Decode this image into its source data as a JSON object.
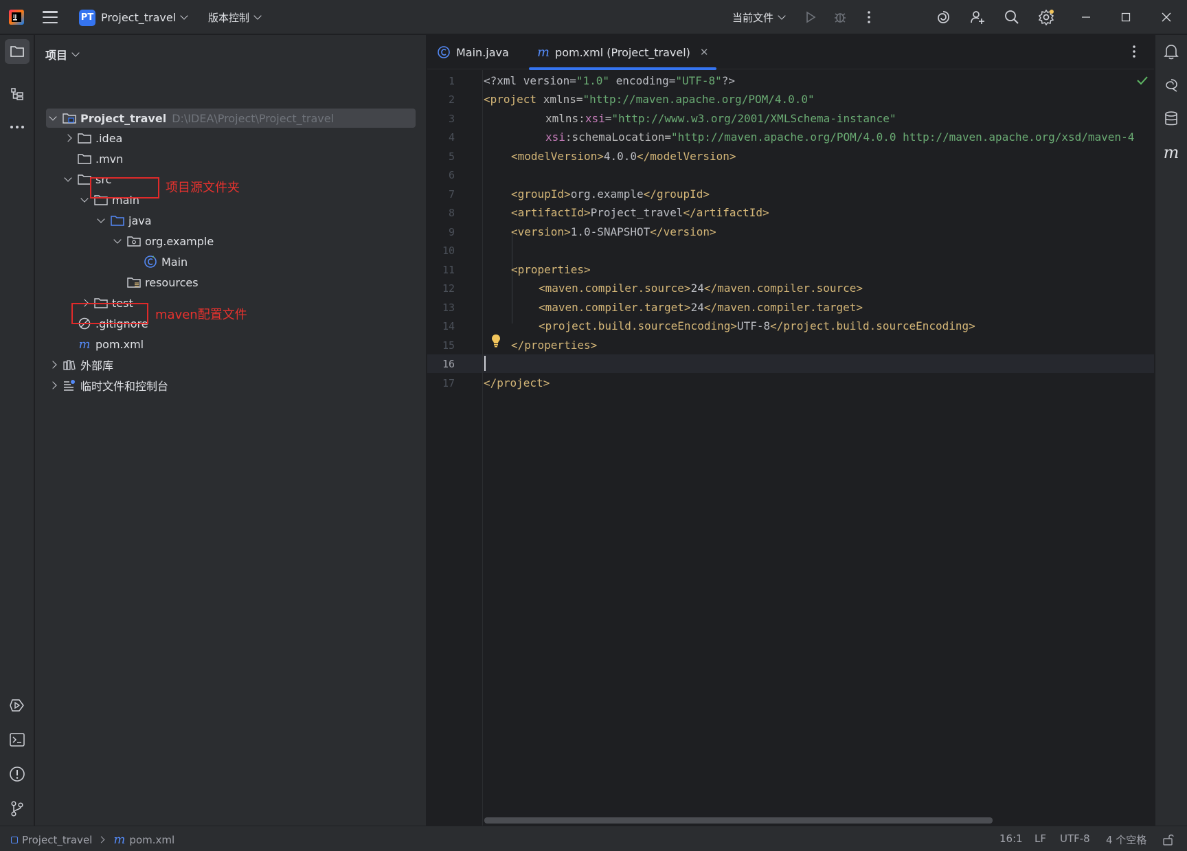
{
  "titlebar": {
    "project_badge": "PT",
    "project_name": "Project_travel",
    "vcs_label": "版本控制",
    "run_config": "当前文件"
  },
  "project_panel": {
    "title": "项目",
    "root_name": "Project_travel",
    "root_path": "D:\\IDEA\\Project\\Project_travel",
    "items": {
      "idea": ".idea",
      "mvn": ".mvn",
      "src": "src",
      "main": "main",
      "java": "java",
      "org_example": "org.example",
      "main_class": "Main",
      "resources": "resources",
      "test": "test",
      "gitignore": ".gitignore",
      "pom": "pom.xml",
      "external_libs": "外部库",
      "scratches": "临时文件和控制台"
    },
    "annotations": {
      "java_note": "项目源文件夹",
      "pom_note": "maven配置文件"
    }
  },
  "editor": {
    "tabs": [
      {
        "label": "Main.java",
        "active": false
      },
      {
        "label": "pom.xml (Project_travel)",
        "active": true
      }
    ],
    "current_line": 16,
    "line_numbers": [
      "1",
      "2",
      "3",
      "4",
      "5",
      "6",
      "7",
      "8",
      "9",
      "10",
      "11",
      "12",
      "13",
      "14",
      "15",
      "16",
      "17"
    ],
    "code": {
      "l1_a": "<?xml version=",
      "l1_b": "\"1.0\"",
      "l1_c": " encoding=",
      "l1_d": "\"UTF-8\"",
      "l1_e": "?>",
      "l2_a": "<project",
      "l2_b": " xmlns=",
      "l2_c": "\"http://maven.apache.org/POM/4.0.0\"",
      "l3_a": "xmlns",
      "l3_b": ":",
      "l3_c": "xsi",
      "l3_d": "=",
      "l3_e": "\"http://www.w3.org/2001/XMLSchema-instance\"",
      "l4_a": "xsi",
      "l4_b": ":schemaLocation=",
      "l4_c": "\"http://maven.apache.org/POM/4.0.0 http://maven.apache.org/xsd/maven-4",
      "l5_a": "<modelVersion>",
      "l5_b": "4.0.0",
      "l5_c": "</modelVersion>",
      "l7_a": "<groupId>",
      "l7_b": "org.example",
      "l7_c": "</groupId>",
      "l8_a": "<artifactId>",
      "l8_b": "Project_travel",
      "l8_c": "</artifactId>",
      "l9_a": "<version>",
      "l9_b": "1.0-SNAPSHOT",
      "l9_c": "</version>",
      "l11": "<properties>",
      "l12_a": "<maven.compiler.source>",
      "l12_b": "24",
      "l12_c": "</maven.compiler.source>",
      "l13_a": "<maven.compiler.target>",
      "l13_b": "24",
      "l13_c": "</maven.compiler.target>",
      "l14_a": "<project.build.sourceEncoding>",
      "l14_b": "UTF-8",
      "l14_c": "</project.build.sourceEncoding>",
      "l15": "</properties>",
      "l17": "</project>"
    }
  },
  "statusbar": {
    "breadcrumb_project": "Project_travel",
    "breadcrumb_file": "pom.xml",
    "position": "16:1",
    "line_sep": "LF",
    "encoding": "UTF-8",
    "indent": "4 个空格"
  },
  "colors": {
    "accent": "#3574f0",
    "annotation_red": "#e02a2a",
    "xml_tag": "#d5b778",
    "xml_string": "#6aab73",
    "xml_namespace": "#c77dbb"
  }
}
